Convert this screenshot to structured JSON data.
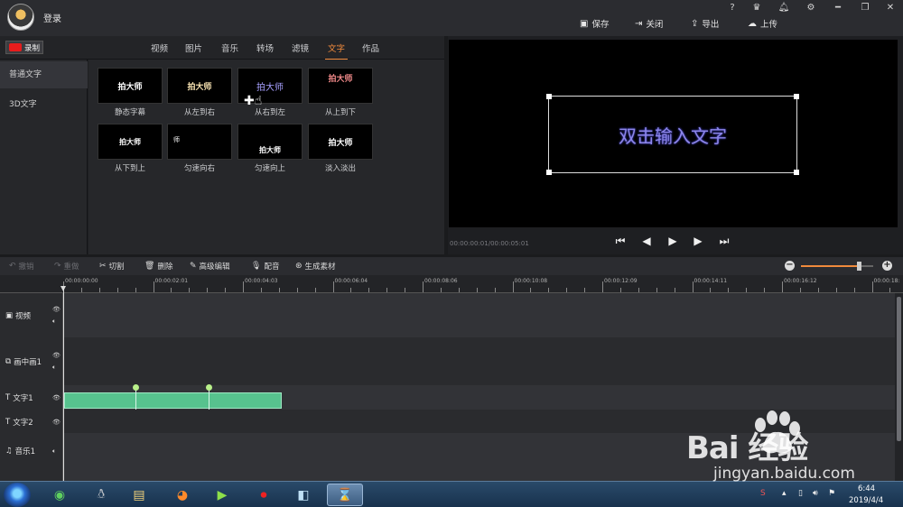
{
  "topbar": {
    "login": "登录",
    "help": "?",
    "buttons": {
      "save": "保存",
      "close": "关闭",
      "export": "导出",
      "upload": "上传"
    }
  },
  "record_label": "录制",
  "tabs": [
    "视频",
    "图片",
    "音乐",
    "转场",
    "滤镜",
    "文字",
    "作品"
  ],
  "active_tab": "文字",
  "sidebar": {
    "items": [
      "普通文字",
      "3D文字"
    ]
  },
  "gallery": {
    "items": [
      {
        "preview": "拍大师",
        "caption": "静态字幕"
      },
      {
        "preview": "拍大师",
        "caption": "从左到右"
      },
      {
        "preview": "拍大师",
        "caption": "从右到左"
      },
      {
        "preview": "拍大师",
        "caption": "从上到下"
      },
      {
        "preview": "拍大师",
        "caption": "从下到上"
      },
      {
        "preview": "师",
        "caption": "匀速向右"
      },
      {
        "preview": "拍大师",
        "caption": "匀速向上"
      },
      {
        "preview": "拍大师",
        "caption": "淡入淡出"
      }
    ]
  },
  "preview": {
    "text": "双击输入文字",
    "timecode": "00:00:00:01/00:00:05:01"
  },
  "toolbar": {
    "undo": "撤销",
    "redo": "重做",
    "cut": "切割",
    "delete": "删除",
    "advanced": "高级编辑",
    "dub": "配音",
    "generate": "生成素材",
    "zoom_level": 0.8
  },
  "ruler": {
    "labels": [
      "00:00:00:00",
      "00:00:02:01",
      "00:00:04:03",
      "00:00:06:04",
      "00:00:08:06",
      "00:00:10:08",
      "00:00:12:09",
      "00:00:14:11",
      "00:00:16:12",
      "00:00:18:"
    ]
  },
  "tracks": {
    "video": "视频",
    "pip": "画中画1",
    "text1": "文字1",
    "text2": "文字2",
    "music": "音乐1"
  },
  "taskbar": {
    "time": "6:44",
    "date": "2019/4/4"
  },
  "watermark": {
    "brand": "Bai  经验",
    "url": "jingyan.baidu.com"
  },
  "colors": {
    "accent": "#f08a3c",
    "clip": "#57c28e",
    "preview_text": "#8d86e8"
  }
}
